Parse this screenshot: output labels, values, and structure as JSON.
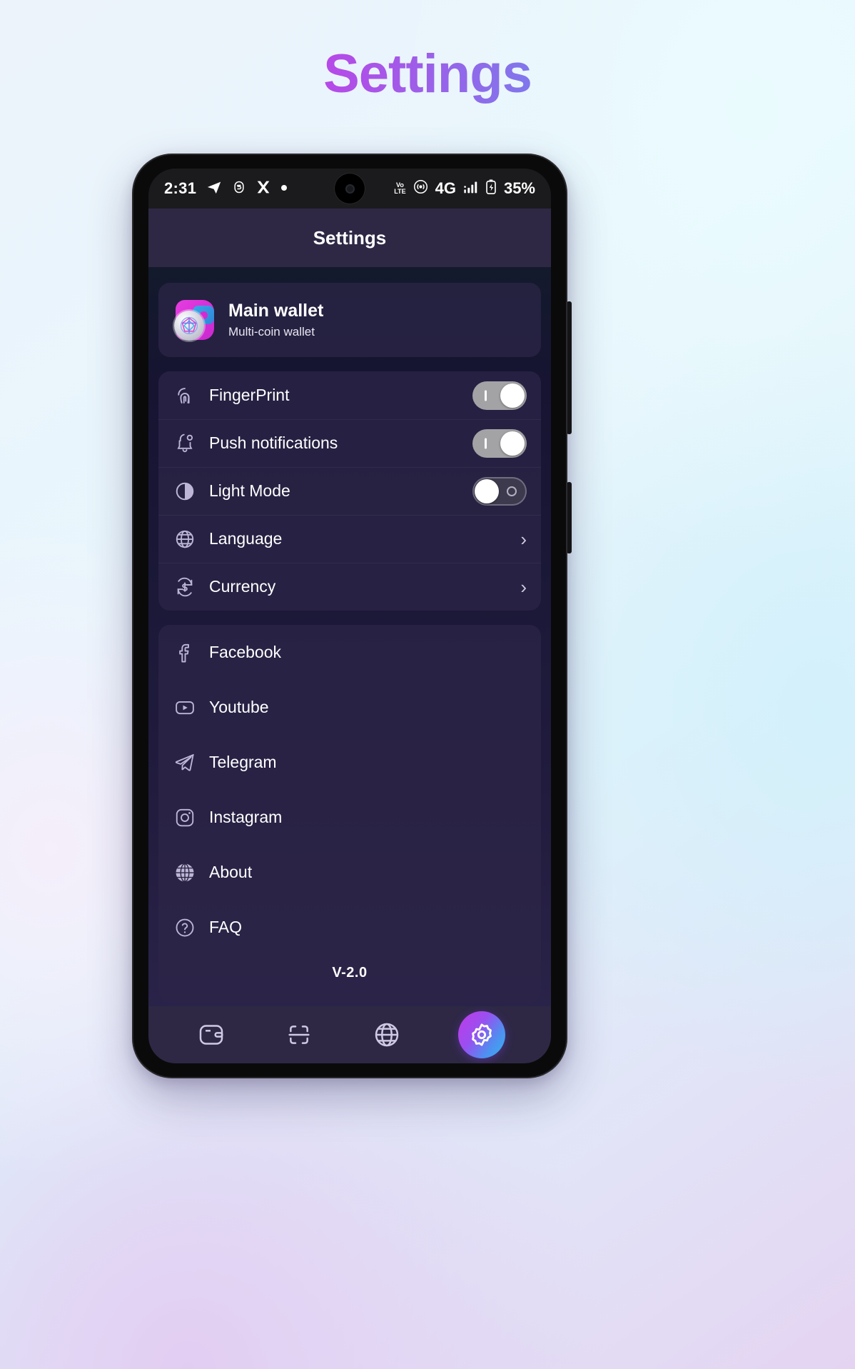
{
  "page": {
    "title": "Settings",
    "title_gradient_from": "#f61ae0",
    "title_gradient_to": "#2aaef0"
  },
  "status_bar": {
    "time": "2:31",
    "battery_percent": "35%",
    "network_type": "4G",
    "volte_top": "Vo",
    "volte_bottom": "LTE",
    "left_icons": [
      "telegram-icon",
      "app-s-icon",
      "x-icon",
      "dot-icon"
    ],
    "right_icons": [
      "volte-icon",
      "hotspot-icon",
      "network-4g-label",
      "signal-bars-icon",
      "battery-charging-icon"
    ]
  },
  "app_header": {
    "title": "Settings"
  },
  "wallet": {
    "name": "Main wallet",
    "subtitle": "Multi-coin wallet",
    "icon": "wallet-avatar-icon"
  },
  "settings": {
    "rows": [
      {
        "label": "FingerPrint",
        "icon": "fingerprint-icon",
        "control": "toggle",
        "state": "on"
      },
      {
        "label": "Push notifications",
        "icon": "bell-icon",
        "control": "toggle",
        "state": "on"
      },
      {
        "label": "Light Mode",
        "icon": "half-circle-icon",
        "control": "toggle",
        "state": "off"
      },
      {
        "label": "Language",
        "icon": "globe-icon",
        "control": "chevron",
        "chevron": "›"
      },
      {
        "label": "Currency",
        "icon": "currency-refresh-icon",
        "control": "chevron",
        "chevron": "›"
      }
    ]
  },
  "links": {
    "rows": [
      {
        "label": "Facebook",
        "icon": "facebook-icon"
      },
      {
        "label": "Youtube",
        "icon": "youtube-icon"
      },
      {
        "label": "Telegram",
        "icon": "telegram-icon"
      },
      {
        "label": "Instagram",
        "icon": "instagram-icon"
      },
      {
        "label": "About",
        "icon": "globe-filled-icon"
      },
      {
        "label": "FAQ",
        "icon": "question-circle-icon"
      }
    ],
    "version": "V-2.0"
  },
  "bottom_nav": {
    "items": [
      {
        "name": "wallet",
        "icon": "wallet-icon",
        "active": false
      },
      {
        "name": "scan",
        "icon": "scan-icon",
        "active": false
      },
      {
        "name": "browser",
        "icon": "globe-icon",
        "active": false
      },
      {
        "name": "settings",
        "icon": "gear-icon",
        "active": true
      }
    ],
    "active_gradient_from": "#c13ae8",
    "active_gradient_to": "#33b4ef"
  }
}
